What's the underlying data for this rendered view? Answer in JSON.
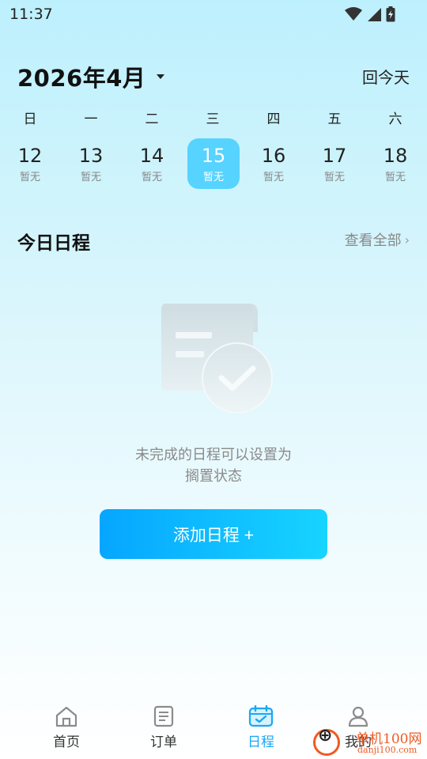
{
  "status": {
    "time": "11:37"
  },
  "header": {
    "month": "2026年4月",
    "today_label": "回今天"
  },
  "weekdays": [
    "日",
    "一",
    "二",
    "三",
    "四",
    "五",
    "六"
  ],
  "dates": [
    {
      "day": "12",
      "sub": "暂无"
    },
    {
      "day": "13",
      "sub": "暂无"
    },
    {
      "day": "14",
      "sub": "暂无"
    },
    {
      "day": "15",
      "sub": "暂无",
      "selected": true
    },
    {
      "day": "16",
      "sub": "暂无"
    },
    {
      "day": "17",
      "sub": "暂无"
    },
    {
      "day": "18",
      "sub": "暂无"
    }
  ],
  "schedule": {
    "title": "今日日程",
    "view_all": "查看全部",
    "empty_line1": "未完成的日程可以设置为",
    "empty_line2": "搁置状态",
    "add_button": "添加日程 +"
  },
  "nav": [
    {
      "label": "首页",
      "icon": "home-icon"
    },
    {
      "label": "订单",
      "icon": "order-icon"
    },
    {
      "label": "日程",
      "icon": "calendar-icon",
      "active": true
    },
    {
      "label": "我的",
      "icon": "user-icon"
    }
  ],
  "watermark": {
    "line1": "单机100网",
    "line2": "danji100.com"
  },
  "colors": {
    "accent": "#19a8f5",
    "selected_date": "#56d3ff",
    "button_start": "#06a6ff",
    "button_end": "#17d4ff"
  }
}
